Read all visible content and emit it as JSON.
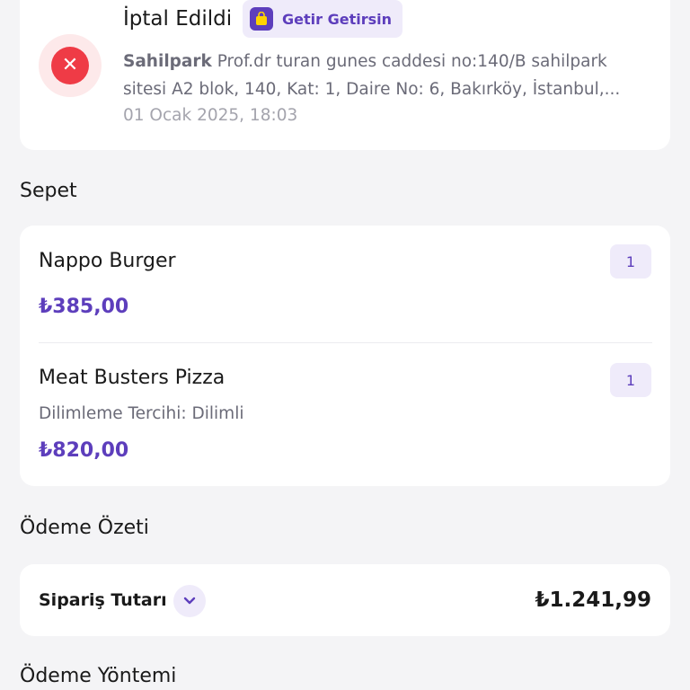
{
  "order": {
    "status": "İptal Edildi",
    "status_icon": "close-icon",
    "provider": "Getir Getirsin",
    "provider_icon": "shopping-bag-icon",
    "address_name": "Sahilpark",
    "address_line1": "Prof.dr turan gunes caddesi no:140/B sahilpark",
    "address_line2": "sitesi A2 blok, 140, Kat: 1, Daire No: 6, Bakırköy, İstanbul,...",
    "date": "01 Ocak 2025, 18:03"
  },
  "basket": {
    "title": "Sepet",
    "items": [
      {
        "name": "Nappo Burger",
        "option": "",
        "price": "₺385,00",
        "qty": "1"
      },
      {
        "name": "Meat Busters Pizza",
        "option": "Dilimleme Tercihi: Dilimli",
        "price": "₺820,00",
        "qty": "1"
      }
    ]
  },
  "payment_summary": {
    "title": "Ödeme Özeti",
    "label": "Sipariş Tutarı",
    "total": "₺1.241,99"
  },
  "payment_method": {
    "title": "Ödeme Yöntemi"
  },
  "colors": {
    "brand": "#5d3ebc",
    "danger": "#ef3b46",
    "background": "#f4f4f6"
  }
}
